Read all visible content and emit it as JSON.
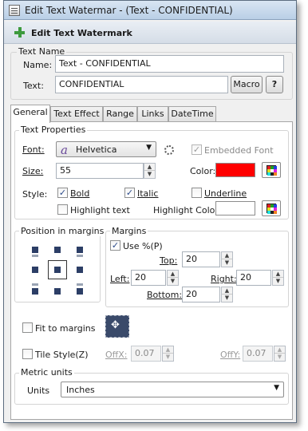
{
  "window": {
    "title": "Edit Text Watermar - (Text - CONFIDENTIAL)"
  },
  "header": {
    "title": "Edit Text Watermark"
  },
  "text_name": {
    "legend": "Text Name",
    "name_label": "Name:",
    "name_value": "Text - CONFIDENTIAL",
    "text_label": "Text:",
    "text_value": "CONFIDENTIAL",
    "macro_label": "Macro",
    "help_label": "?"
  },
  "tabs": [
    "General",
    "Text Effect",
    "Range",
    "Links",
    "DateTime"
  ],
  "text_properties": {
    "legend": "Text Properties",
    "font_label": "Font:",
    "font_value": "Helvetica",
    "embedded_font_label": "Embedded Font",
    "size_label": "Size:",
    "size_value": "55",
    "color_label": "Color:",
    "color_value": "#ff0000",
    "style_label": "Style:",
    "bold_label": "Bold",
    "italic_label": "Italic",
    "underline_label": "Underline",
    "highlight_text_label": "Highlight text",
    "highlight_color_label": "Highlight Color:",
    "highlight_color_value": "#ffffff"
  },
  "position": {
    "legend": "Position in margins"
  },
  "margins": {
    "legend": "Margins",
    "use_percent_label": "Use %(P)",
    "top_label": "Top:",
    "top_value": "20",
    "left_label": "Left:",
    "left_value": "20",
    "right_label": "Right:",
    "right_value": "20",
    "bottom_label": "Bottom:",
    "bottom_value": "20"
  },
  "fit_to_margins_label": "Fit to margins",
  "tile": {
    "tile_style_label": "Tile Style(Z)",
    "offx_label": "OffX:",
    "offx_value": "0.07",
    "offy_label": "OffY:",
    "offy_value": "0.07"
  },
  "metric": {
    "legend": "Metric units",
    "units_label": "Units",
    "units_value": "Inches"
  },
  "palette_colors": [
    "#e02020",
    "#20a020",
    "#2040e0",
    "#e0e020",
    "#ffffff",
    "#e020e0",
    "#20e0e0",
    "#202020",
    "#f08020"
  ]
}
